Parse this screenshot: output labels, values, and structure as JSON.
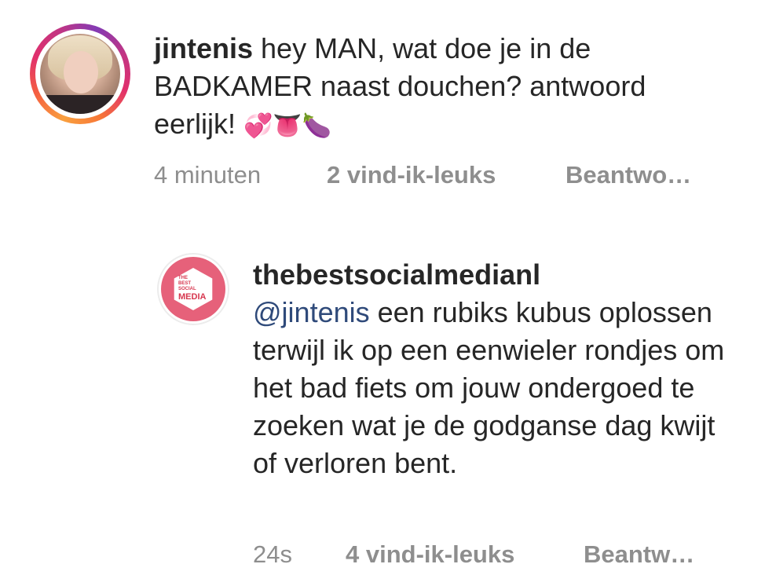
{
  "comment1": {
    "username": "jintenis",
    "text": " hey MAN, wat doe je in de BADKAMER naast douchen? antwoord eerlijk! ",
    "emojis": "💞👅🍆",
    "time": "4 minuten",
    "likes": "2 vind-ik-leuks",
    "reply": "Beantwo…"
  },
  "comment2": {
    "username": "thebestsocialmedianl",
    "mention": "@jintenis",
    "text": " een rubiks kubus oplossen terwijl ik op een eenwieler rondjes om het bad fiets om jouw ondergoed te zoeken wat je de godganse dag kwijt of verloren bent.",
    "time": "24s",
    "likes": "4 vind-ik-leuks",
    "reply": "Beantw…",
    "avatar_logo": {
      "line1": "THE",
      "line2": "BEST",
      "line3": "SOCIAL",
      "line4": "MEDIA"
    }
  },
  "colors": {
    "text": "#262626",
    "muted": "#8e8e8e",
    "mention": "#2f4a7a",
    "brand": "#e6617a"
  }
}
